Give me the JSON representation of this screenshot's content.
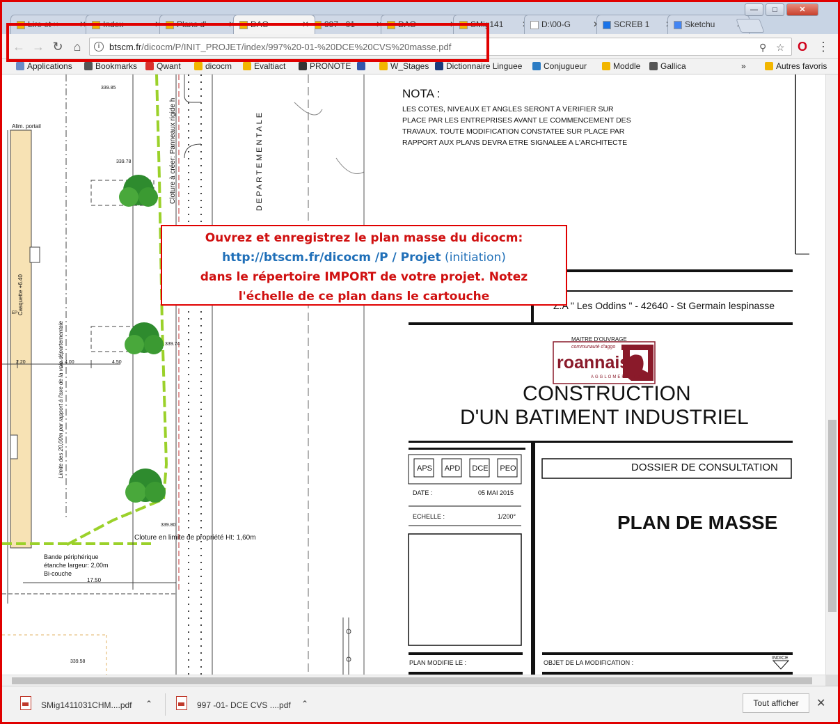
{
  "window": {
    "tabs": [
      {
        "label": "Lire et ×",
        "fav_color": "#f2b600"
      },
      {
        "label": "Index",
        "fav_color": "#f2b600"
      },
      {
        "label": "Plans d'",
        "fav_color": "#f2b600"
      },
      {
        "label": "DAO",
        "fav_color": "#f2b600"
      },
      {
        "label": "997 - 01",
        "fav_color": "#f2b600"
      },
      {
        "label": "DAO",
        "fav_color": "#f2b600"
      },
      {
        "label": "SMig141",
        "fav_color": "#f2b600"
      },
      {
        "label": "D:\\00-G",
        "fav_color": "#ffffff"
      },
      {
        "label": "SCREB 1",
        "fav_color": "#1a73e8"
      },
      {
        "label": "Sketchu",
        "fav_color": "#4285f4"
      }
    ],
    "minimize": "—",
    "maximize": "□",
    "close": "✕"
  },
  "toolbar": {
    "url_host": "btscm.fr",
    "url_path": "/dicocm/P/INIT_PROJET/index/997%20-01-%20DCE%20CVS%20masse.pdf",
    "info_icon": "i"
  },
  "bookmarks": [
    {
      "label": "Applications",
      "color": "#6a8cc7"
    },
    {
      "label": "Bookmarks",
      "color": "#555555"
    },
    {
      "label": "Qwant",
      "color": "#d9302c"
    },
    {
      "label": "dicocm",
      "color": "#f2b600"
    },
    {
      "label": "Evaltiact",
      "color": "#f2b600"
    },
    {
      "label": "PRONOTE",
      "color": "#333333"
    },
    {
      "label": "",
      "color": "#3355aa"
    },
    {
      "label": "W_Stages",
      "color": "#f2b600"
    },
    {
      "label": "Dictionnaire Linguee",
      "color": "#1b3a7a"
    },
    {
      "label": "Conjugueur",
      "color": "#2b7cc4"
    },
    {
      "label": "Moddle",
      "color": "#f2b600"
    },
    {
      "label": "Gallica",
      "color": "#555555"
    },
    {
      "label": "»",
      "color": ""
    },
    {
      "label": "Autres favoris",
      "color": "#f2b600"
    }
  ],
  "plan": {
    "nota_title": "NOTA :",
    "nota_lines": [
      "LES COTES, NIVEAUX ET ANGLES SERONT A VERIFIER SUR",
      "PLACE PAR LES ENTREPRISES AVANT LE COMMENCEMENT DES",
      "TRAVAUX. TOUTE MODIFICATION CONSTATEE SUR PLACE PAR",
      "RAPPORT AUX PLANS DEVRA ETRE SIGNALEE A L'ARCHITECTE"
    ],
    "address": "Z.A \" Les Oddins \" - 42640 - St Germain lespinasse",
    "maitre_ouvrage": "MAITRE D'OUVRAGE",
    "logo_small": "communauté d'aggo",
    "logo_word": "roannais",
    "logo_sub": "AGGLOMERATION",
    "title_line1": "CONSTRUCTION",
    "title_line2": "D'UN BATIMENT INDUSTRIEL",
    "phases": [
      "APS",
      "APD",
      "DCE",
      "PEO"
    ],
    "dossier": "DOSSIER DE CONSULTATION",
    "date_label": "DATE :",
    "date_value": "05 MAI 2015",
    "echelle_label": "ECHELLE :",
    "echelle_value": "1/200°",
    "plan_title": "PLAN DE MASSE",
    "plan_modifie": "PLAN MODIFIE LE :",
    "objet_modif": "OBJET DE LA MODIFICATION :",
    "indice": "INDICE",
    "road_label": "DEPARTEMENTALE",
    "cloture_vertical": "Cloture à créer: Panneaux rigide h",
    "limite_vertical": "Limite des 20,00m par rapport à l'axe de la voie départementale",
    "casquette": "Casquette +6.40",
    "alim": "Alim. portail",
    "cloture_label": "Cloture en limite de propriété Ht: 1,60m",
    "bande1": "Bande périphérique",
    "bande2": "étanche largeur: 2,00m",
    "bande3": "Bi-couche",
    "dims": [
      "339.85",
      "339.78",
      "339.74",
      "339.80",
      "339.58",
      "2.20",
      "4.00",
      "4.50",
      "17.50",
      "EP"
    ]
  },
  "instruction": {
    "line1": "Ouvrez et enregistrez le plan masse du dicocm:",
    "line2_link": "http://btscm.fr/dicocm /P / Projet",
    "line2_paren": " (initiation)",
    "line3": "dans le répertoire IMPORT de votre projet. Notez",
    "line4": "l'échelle de ce plan dans le cartouche"
  },
  "downloads": {
    "items": [
      "SMig1411031CHM....pdf",
      "997 -01- DCE CVS ....pdf"
    ],
    "show_all": "Tout afficher",
    "close": "✕"
  }
}
